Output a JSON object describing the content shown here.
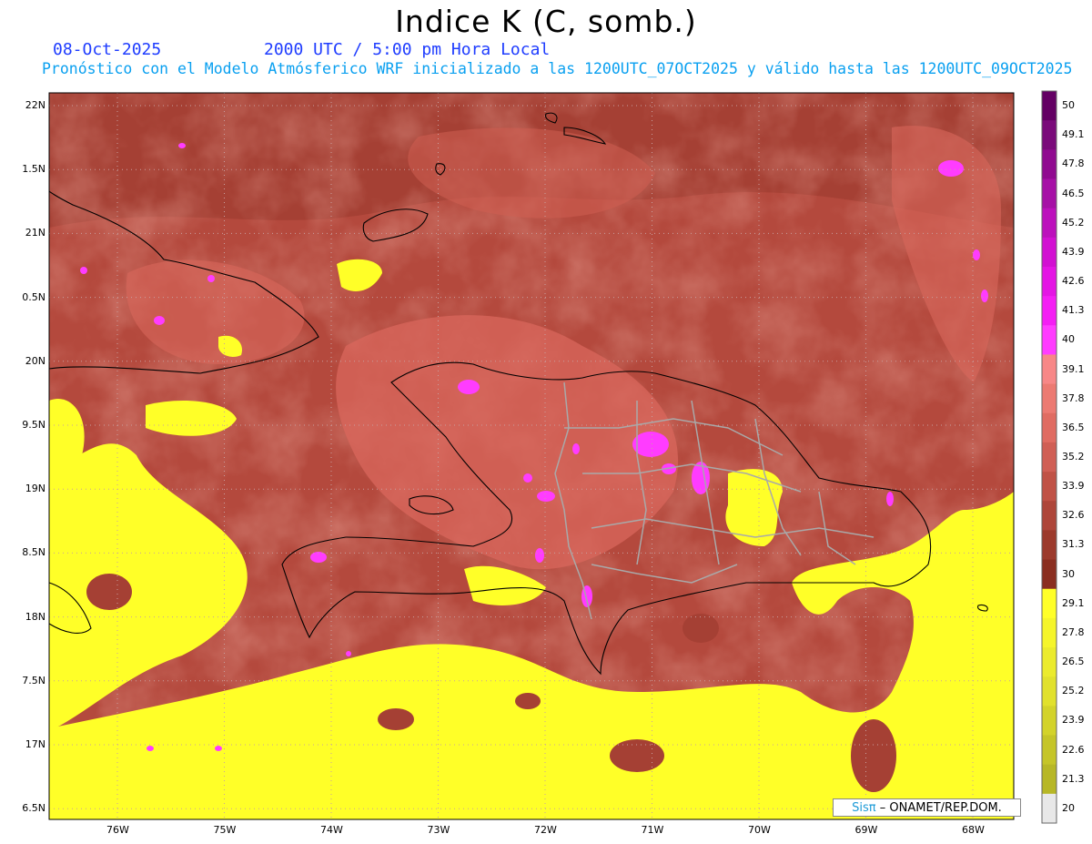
{
  "title": "Indice K (C, somb.)",
  "date": "08-Oct-2025",
  "time": "2000 UTC / 5:00 pm Hora Local",
  "description": "Pronóstico con el Modelo Atmósferico WRF inicializado a las 1200UTC_07OCT2025 y válido hasta las  1200UTC_09OCT2025",
  "lat_ticks": [
    "22N",
    "1.5N",
    "21N",
    "0.5N",
    "20N",
    "9.5N",
    "19N",
    "8.5N",
    "18N",
    "7.5N",
    "17N",
    "6.5N"
  ],
  "lon_ticks": [
    "76W",
    "75W",
    "74W",
    "73W",
    "72W",
    "71W",
    "70W",
    "69W",
    "68W"
  ],
  "colorbar": {
    "labels": [
      "50",
      "49.1",
      "47.8",
      "46.5",
      "45.2",
      "43.9",
      "42.6",
      "41.3",
      "40",
      "39.1",
      "37.8",
      "36.5",
      "35.2",
      "33.9",
      "32.6",
      "31.3",
      "30",
      "29.1",
      "27.8",
      "26.5",
      "25.2",
      "23.9",
      "22.6",
      "21.3",
      "20"
    ],
    "colors": [
      "#640064",
      "#7a0a7a",
      "#900a90",
      "#a610a6",
      "#bc10bc",
      "#d210d2",
      "#e415e4",
      "#f41ef4",
      "#ff3cff",
      "#f78787",
      "#ec7a72",
      "#e06c62",
      "#d05f55",
      "#c05246",
      "#ae463a",
      "#9c3a2c",
      "#8a2e20",
      "#ffff28",
      "#f5f52a",
      "#ebeb2c",
      "#e1e12c",
      "#d3d32a",
      "#c5c528",
      "#b7b726",
      "#e8e8e8"
    ]
  },
  "credit": {
    "logo": "Sisπ",
    "text": "– ONAMET/REP.DOM."
  },
  "colors": {
    "low": "#ffff28",
    "mid": "#9c3a2c",
    "high": "#e06c62",
    "peak": "#ff3cff"
  }
}
